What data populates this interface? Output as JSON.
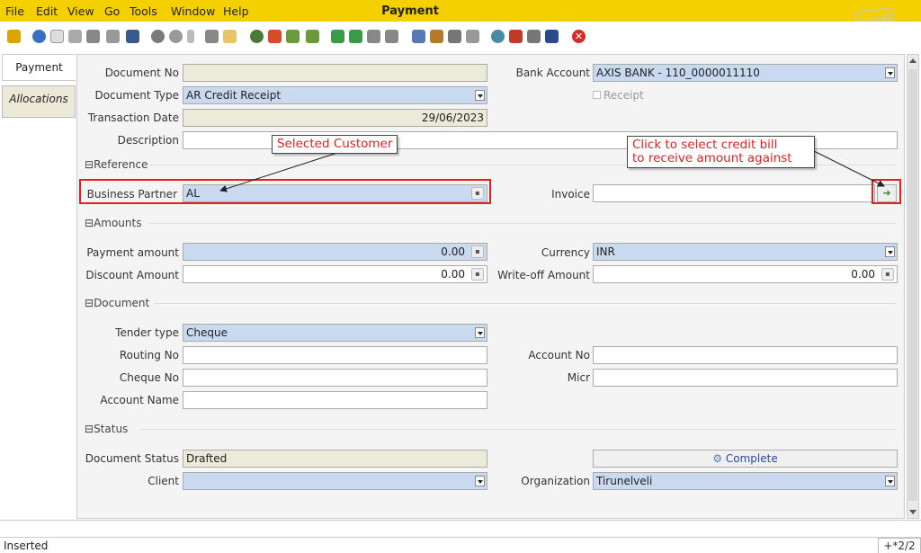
{
  "menu": [
    "File",
    "Edit",
    "View",
    "Go",
    "Tools",
    "Window",
    "Help"
  ],
  "app_title": "Payment",
  "logo_text": "Jaldi",
  "tabs": [
    "Payment",
    "Allocations"
  ],
  "form": {
    "document_no": {
      "label": "Document No",
      "value": ""
    },
    "bank_account": {
      "label": "Bank Account",
      "value": "AXIS BANK - 110_0000011110"
    },
    "document_type": {
      "label": "Document Type",
      "value": "AR Credit Receipt"
    },
    "receipt": {
      "label": "Receipt"
    },
    "transaction_date": {
      "label": "Transaction Date",
      "value": "29/06/2023"
    },
    "description": {
      "label": "Description",
      "value": ""
    },
    "reference_section": "Reference",
    "business_partner": {
      "label": "Business Partner",
      "value": "AL"
    },
    "invoice": {
      "label": "Invoice",
      "value": ""
    },
    "amounts_section": "Amounts",
    "payment_amount": {
      "label": "Payment amount",
      "value": "0.00"
    },
    "currency": {
      "label": "Currency",
      "value": "INR"
    },
    "discount_amount": {
      "label": "Discount Amount",
      "value": "0.00"
    },
    "writeoff_amount": {
      "label": "Write-off Amount",
      "value": "0.00"
    },
    "document_section": "Document",
    "tender_type": {
      "label": "Tender type",
      "value": "Cheque"
    },
    "routing_no": {
      "label": "Routing No",
      "value": ""
    },
    "account_no": {
      "label": "Account No",
      "value": ""
    },
    "cheque_no": {
      "label": "Cheque No",
      "value": ""
    },
    "micr": {
      "label": "Micr",
      "value": ""
    },
    "account_name": {
      "label": "Account Name",
      "value": ""
    },
    "status_section": "Status",
    "document_status": {
      "label": "Document Status",
      "value": "Drafted"
    },
    "complete_button": "Complete",
    "client": {
      "label": "Client",
      "value": ""
    },
    "organization": {
      "label": "Organization",
      "value": "Tirunelveli"
    }
  },
  "annotations": {
    "selected_customer": "Selected Customer",
    "credit_bill_line1": "Click to select credit bill",
    "credit_bill_line2": "to receive amount against"
  },
  "status_bar": {
    "text": "Inserted",
    "record_nav": "+*2/2"
  },
  "colors": {
    "menubar": "#f5d000",
    "annotation_red": "#e02020",
    "field_blue": "#c9daf0",
    "readonly": "#ecead8"
  }
}
